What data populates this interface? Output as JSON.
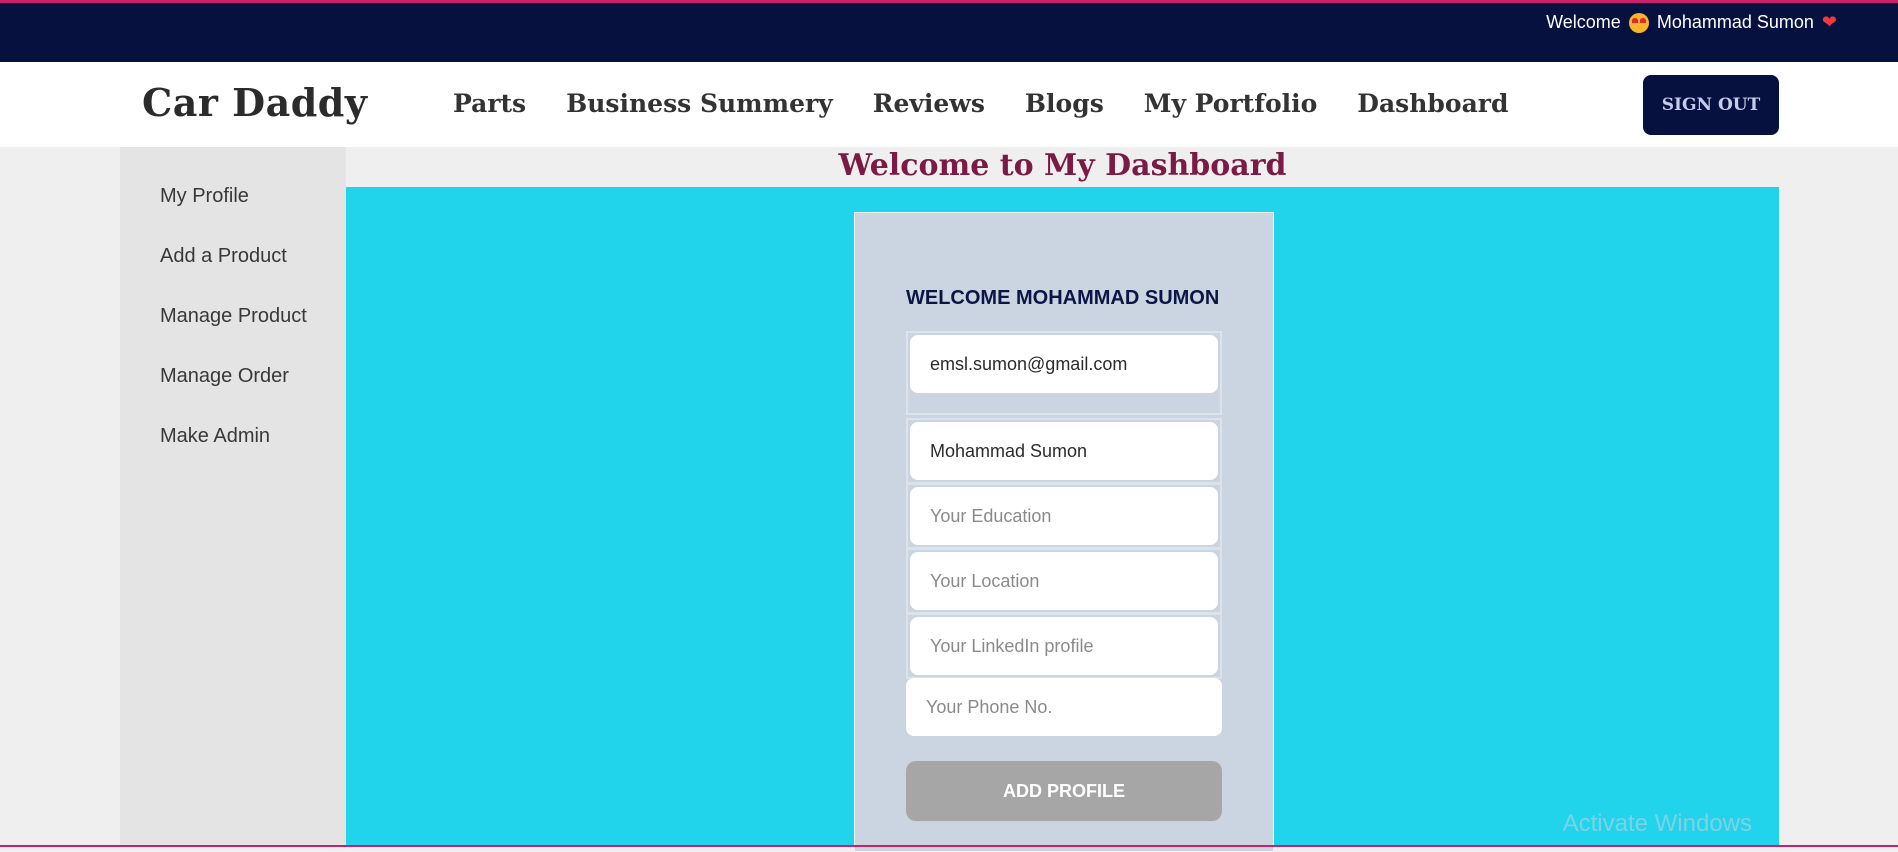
{
  "topbar": {
    "welcome_text": "Welcome",
    "user_name": "Mohammad Sumon",
    "emoji_icon": "star-struck-face-icon",
    "heart_icon": "red-heart-icon",
    "heart_glyph": "❤",
    "accent_color": "#c8206a",
    "background_color": "#07113f"
  },
  "nav": {
    "brand": "Car Daddy",
    "links": [
      "Parts",
      "Business Summery",
      "Reviews",
      "Blogs",
      "My Portfolio",
      "Dashboard"
    ],
    "sign_out_label": "SIGN OUT"
  },
  "sidebar": {
    "items": [
      {
        "label": "My Profile"
      },
      {
        "label": "Add a Product"
      },
      {
        "label": "Manage Product"
      },
      {
        "label": "Manage Order"
      },
      {
        "label": "Make Admin"
      }
    ]
  },
  "main": {
    "title": "Welcome to My Dashboard",
    "panel_color": "#22d3ec"
  },
  "profile_form": {
    "heading": "WELCOME MOHAMMAD SUMON",
    "email_value": "emsl.sumon@gmail.com",
    "name_value": "Mohammad Sumon",
    "education_placeholder": "Your Education",
    "location_placeholder": "Your Location",
    "linkedin_placeholder": "Your LinkedIn profile",
    "phone_placeholder": "Your Phone No.",
    "submit_label": "ADD PROFILE"
  },
  "watermark": {
    "text": "Activate Windows"
  }
}
